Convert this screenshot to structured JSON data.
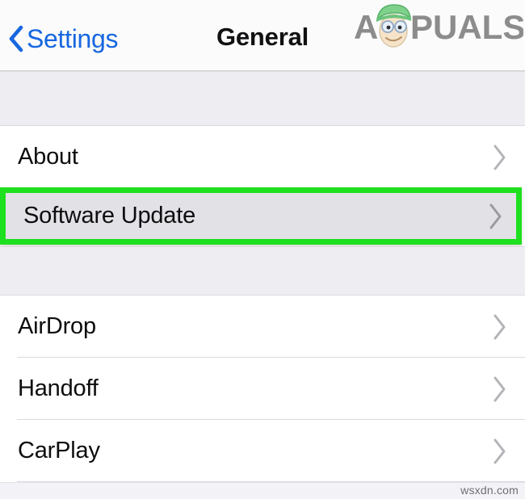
{
  "navbar": {
    "back_label": "Settings",
    "back_icon": "chevron-left-icon",
    "title": "General",
    "accent_color": "#1767e0",
    "title_color": "#111113",
    "background_color": "#fbfbfb"
  },
  "watermark": {
    "brand_text_left": "A",
    "brand_text_right": "PUALS",
    "brand_color": "#8c8c8c",
    "cap_color": "#7fd08a",
    "face_color": "#f6e3c8",
    "mascot_icon": "appuals-mascot-icon",
    "footer_text": "wsxdn.com",
    "footer_color": "#6e6e74"
  },
  "highlight": {
    "border_color": "#1ee01e",
    "row_background": "#e2e2e6",
    "target_row": "Software Update"
  },
  "sections": [
    {
      "name": "section-one",
      "rows": [
        {
          "label": "About",
          "accessory": "chevron-right-icon",
          "highlighted": false
        },
        {
          "label": "Software Update",
          "accessory": "chevron-right-icon",
          "highlighted": true
        }
      ]
    },
    {
      "name": "section-two",
      "rows": [
        {
          "label": "AirDrop",
          "accessory": "chevron-right-icon",
          "highlighted": false
        },
        {
          "label": "Handoff",
          "accessory": "chevron-right-icon",
          "highlighted": false
        },
        {
          "label": "CarPlay",
          "accessory": "chevron-right-icon",
          "highlighted": false
        }
      ]
    }
  ],
  "colors": {
    "group_background": "#eeeef2",
    "row_background": "#ffffff",
    "separator": "#dadade",
    "chevron": "#b4b4b8"
  }
}
